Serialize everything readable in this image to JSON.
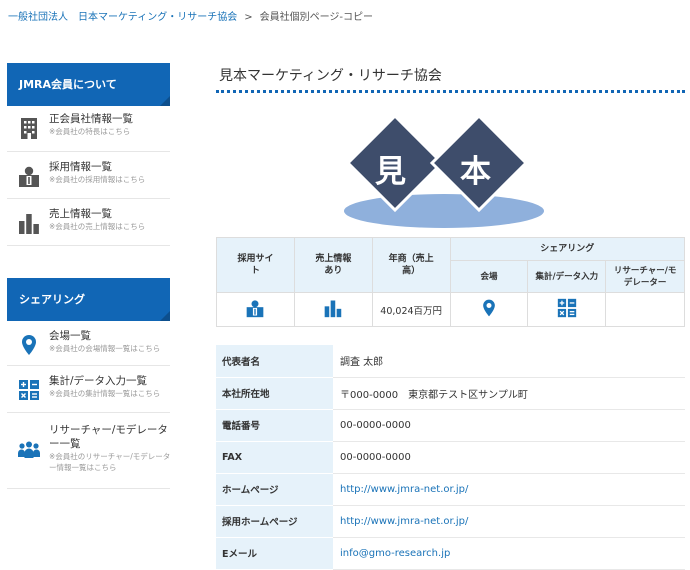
{
  "breadcrumb": {
    "items": [
      "一般社団法人　日本マーケティング・リサーチ協会",
      "会員社個別ページ-コピー"
    ],
    "separator": ">"
  },
  "sidebar": {
    "sections": [
      {
        "header": "JMRA会員について",
        "items": [
          {
            "label": "正会員社情報一覧",
            "sub": "※会員社の特長はこちら",
            "icon": "building-icon"
          },
          {
            "label": "採用情報一覧",
            "sub": "※会員社の採用情報はこちら",
            "icon": "employee-icon"
          },
          {
            "label": "売上情報一覧",
            "sub": "※会員社の売上情報はこちら",
            "icon": "bar-chart-icon"
          }
        ]
      },
      {
        "header": "シェアリング",
        "items": [
          {
            "label": "会場一覧",
            "sub": "※会員社の会場情報一覧はこちら",
            "icon": "location-pin-icon"
          },
          {
            "label": "集計/データ入力一覧",
            "sub": "※会員社の集計情報一覧はこちら",
            "icon": "calculator-icon"
          },
          {
            "label": "リサーチャー/モデレーター一覧",
            "sub": "※会員社のリサーチャー/モデレーター情報一覧はこちら",
            "icon": "people-icon"
          }
        ]
      }
    ]
  },
  "main": {
    "title": "見本マーケティング・リサーチ協会",
    "hero_chars": [
      "見",
      "本"
    ],
    "summary": {
      "headers": [
        "採用サイト",
        "売上情報あり",
        "年商（売上高）",
        "シェアリング"
      ],
      "sharing_sub": [
        "会場",
        "集計/データ入力",
        "リサーチャー/モデレーター"
      ],
      "revenue": "40,024百万円"
    },
    "details": [
      {
        "label": "代表者名",
        "value": "調査 太郎"
      },
      {
        "label": "本社所在地",
        "value": "〒000-0000　東京都テスト区サンプル町"
      },
      {
        "label": "電話番号",
        "value": "00-0000-0000"
      },
      {
        "label": "FAX",
        "value": "00-0000-0000"
      },
      {
        "label": "ホームページ",
        "value": "http://www.jmra-net.or.jp/"
      },
      {
        "label": "採用ホームページ",
        "value": "http://www.jmra-net.or.jp/"
      },
      {
        "label": "Eメール",
        "value": "info@gmo-research.jp"
      }
    ]
  },
  "colors": {
    "brand": "#1166b5",
    "diamond": "#3e4d6b",
    "header_bg": "#e6f2fa",
    "link": "#1a73b8"
  }
}
